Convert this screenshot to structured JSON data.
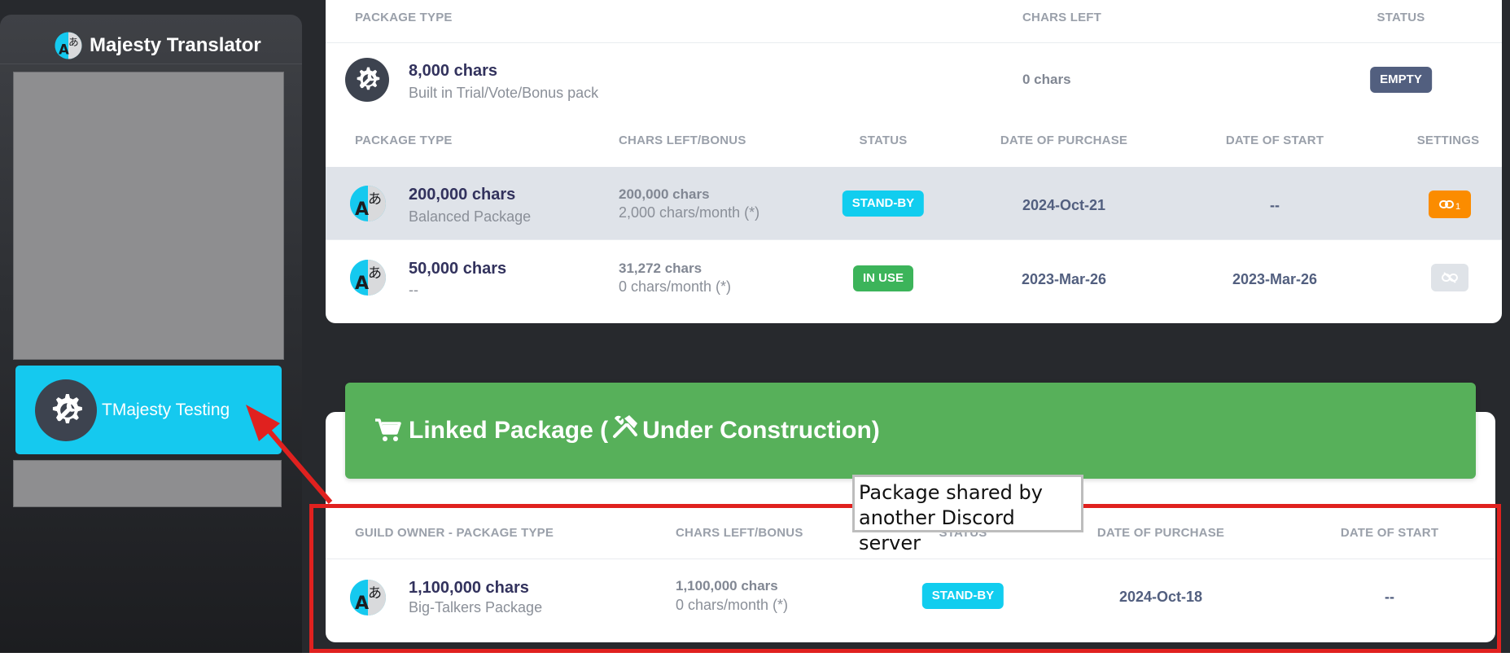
{
  "sidebar": {
    "brand": "Majesty Translator",
    "active_server": "TMajesty Testing"
  },
  "top_table": {
    "headers": {
      "package_type": "PACKAGE TYPE",
      "chars_left": "CHARS LEFT",
      "status": "STATUS"
    },
    "row": {
      "title": "8,000 chars",
      "subtitle": "Built in Trial/Vote/Bonus pack",
      "chars_left": "0 chars",
      "status": "EMPTY"
    }
  },
  "purchased_table": {
    "headers": {
      "package_type": "PACKAGE TYPE",
      "chars_left_bonus": "CHARS LEFT/BONUS",
      "status": "STATUS",
      "date_of_purchase": "DATE OF PURCHASE",
      "date_of_start": "DATE OF START",
      "settings": "SETTINGS"
    },
    "rows": [
      {
        "title": "200,000 chars",
        "subtitle": "Balanced Package",
        "chars_left": "200,000 chars",
        "bonus": "2,000 chars/month (*)",
        "status": "STAND-BY",
        "purchase": "2024-Oct-21",
        "start": "--",
        "link_count": "1"
      },
      {
        "title": "50,000 chars",
        "subtitle": "--",
        "chars_left": "31,272 chars",
        "bonus": "0 chars/month (*)",
        "status": "IN USE",
        "purchase": "2023-Mar-26",
        "start": "2023-Mar-26"
      }
    ]
  },
  "banner": {
    "text_a": "Linked Package (",
    "text_b": "Under Construction)"
  },
  "linked_table": {
    "headers": {
      "package_type": "GUILD OWNER - PACKAGE TYPE",
      "chars_left_bonus": "CHARS LEFT/BONUS",
      "status": "STATUS",
      "date_of_purchase": "DATE OF PURCHASE",
      "date_of_start": "DATE OF START"
    },
    "row": {
      "title": "1,100,000 chars",
      "subtitle": "Big-Talkers Package",
      "chars_left": "1,100,000 chars",
      "bonus": "0 chars/month (*)",
      "status": "STAND-BY",
      "purchase": "2024-Oct-18",
      "start": "--"
    }
  },
  "annotation": {
    "callout": "Package shared by another Discord server"
  },
  "colors": {
    "accent": "#11cdef",
    "success": "#3cb45a",
    "warning": "#fb8c00",
    "annotation_red": "#e0211f",
    "sidebar_dark": "#27292d"
  }
}
